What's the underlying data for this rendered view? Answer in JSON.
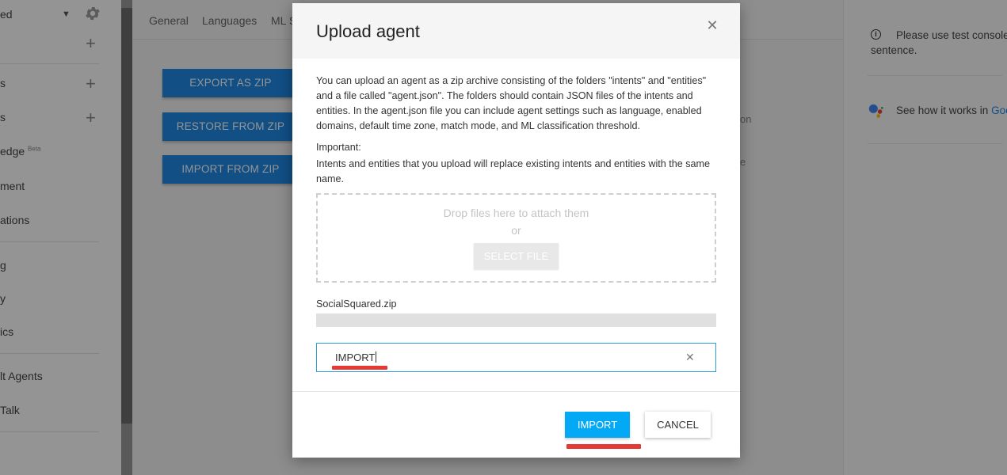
{
  "sidebar": {
    "agent_name_fragment": "ed",
    "items": [
      {
        "label": "s",
        "has_plus": true
      },
      {
        "label": "s",
        "has_plus": true
      },
      {
        "label": "edge",
        "badge": "Beta"
      },
      {
        "label": "ment"
      },
      {
        "label": "ations"
      },
      {
        "label": "g"
      },
      {
        "label": "y"
      },
      {
        "label": "ics"
      },
      {
        "label": "lt Agents"
      },
      {
        "label": "Talk"
      }
    ]
  },
  "tabs": [
    "General",
    "Languages",
    "ML S"
  ],
  "export": {
    "buttons": [
      "EXPORT AS ZIP",
      "RESTORE FROM ZIP",
      "IMPORT FROM ZIP"
    ],
    "hint_fragments": [
      "on",
      "e"
    ]
  },
  "right_panel": {
    "test_console_line1": "Please use test console",
    "test_console_line2": "sentence.",
    "how_it_works": "See how it works in ",
    "how_it_works_link": "Goo"
  },
  "dialog": {
    "title": "Upload agent",
    "close_icon": "close-icon",
    "description": "You can upload an agent as a zip archive consisting of the folders \"intents\" and \"entities\" and a file called \"agent.json\". The folders should contain JSON files of the intents and entities. In the agent.json file you can include agent settings such as language, enabled domains, default time zone, match mode, and ML classification threshold.",
    "important_label": "Important:",
    "important_text": "Intents and entities that you upload will replace existing intents and entities with the same name.",
    "dropzone": {
      "text": "Drop files here to attach them",
      "or": "or",
      "select_file": "SELECT FILE"
    },
    "file_name": "SocialSquared.zip",
    "upload_progress": 1.0,
    "confirm_input_value": "IMPORT",
    "import_button": "IMPORT",
    "cancel_button": "CANCEL"
  },
  "colors": {
    "primary_blue": "#1e88e5",
    "import_blue": "#03a9f4",
    "annotation_red": "#e53935",
    "overlay": "rgba(0,0,0,0.42)"
  }
}
